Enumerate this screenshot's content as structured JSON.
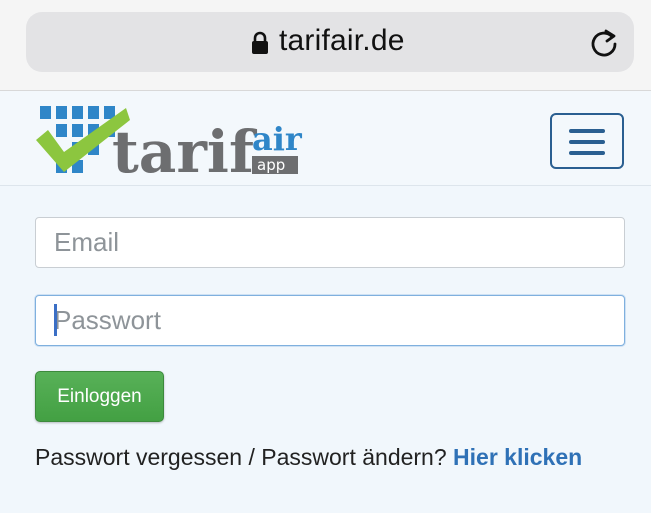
{
  "browser": {
    "url": "tarifair.de",
    "lock_icon": "lock-icon",
    "reload_icon": "reload-icon"
  },
  "navbar": {
    "logo_text": "tarifair app",
    "menu_icon": "hamburger-menu-icon"
  },
  "form": {
    "email_placeholder": "Email",
    "email_value": "",
    "password_placeholder": "Passwort",
    "password_value": "",
    "login_label": "Einloggen",
    "forgot_text": "Passwort vergessen / Passwort ändern?",
    "forgot_link": "Hier klicken"
  },
  "colors": {
    "login_button": "#4cae4c",
    "link": "#2f71b6",
    "brand_blue": "#2f86c8",
    "brand_green": "#8cc63f",
    "brand_grey": "#6d6e70"
  }
}
